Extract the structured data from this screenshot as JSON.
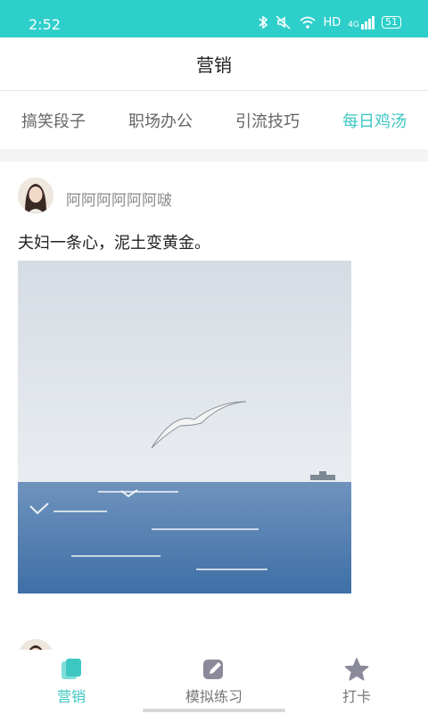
{
  "status_bar": {
    "time": "2:52",
    "network": "HD",
    "signal": "4G",
    "battery": "51"
  },
  "header": {
    "title": "营销"
  },
  "tabs": [
    {
      "label": "搞笑段子",
      "active": false
    },
    {
      "label": "职场办公",
      "active": false
    },
    {
      "label": "引流技巧",
      "active": false
    },
    {
      "label": "每日鸡汤",
      "active": true
    }
  ],
  "post": {
    "author": "阿阿阿阿阿阿啵",
    "text": "夫妇一条心，泥土变黄金。"
  },
  "bottom_nav": [
    {
      "label": "营销",
      "icon": "copy-icon",
      "active": true
    },
    {
      "label": "模拟练习",
      "icon": "edit-icon",
      "active": false
    },
    {
      "label": "打卡",
      "icon": "star-icon",
      "active": false
    }
  ],
  "colors": {
    "accent": "#3dc7c2",
    "status_bar": "#2ecfca"
  }
}
